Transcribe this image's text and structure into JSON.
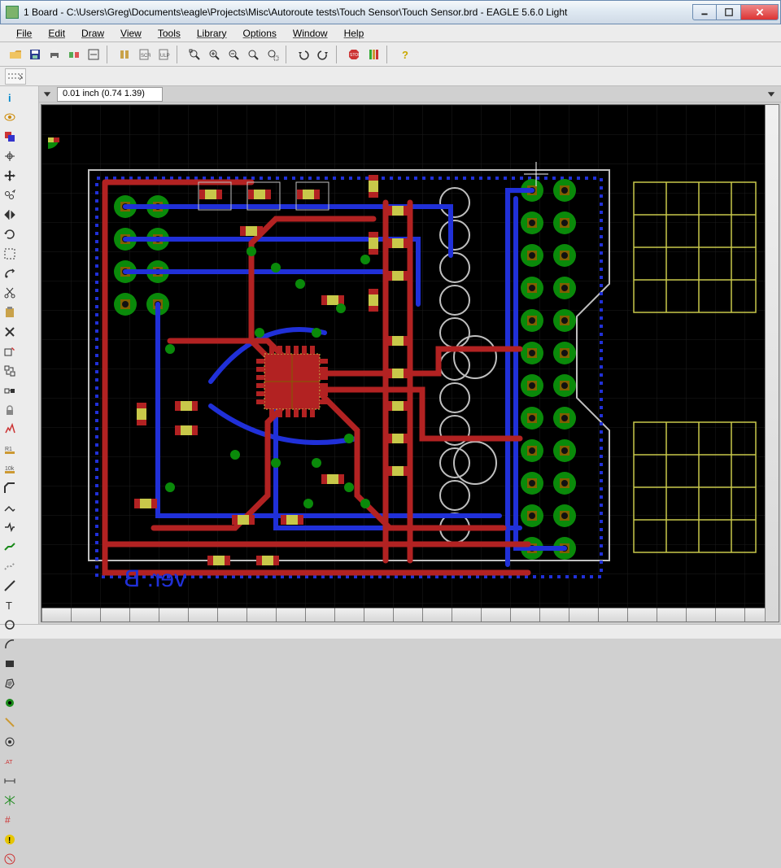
{
  "window": {
    "title": "1 Board - C:\\Users\\Greg\\Documents\\eagle\\Projects\\Misc\\Autoroute tests\\Touch Sensor\\Touch Sensor.brd - EAGLE 5.6.0 Light"
  },
  "menu": {
    "items": [
      "File",
      "Edit",
      "Draw",
      "View",
      "Tools",
      "Library",
      "Options",
      "Window",
      "Help"
    ]
  },
  "toolbar_top": {
    "open": "open",
    "save": "save",
    "print": "print",
    "cam": "cam",
    "board": "board",
    "lib": "lib",
    "script": "script",
    "ulp": "ulp",
    "zoomfit": "zoomfit",
    "zoomin": "zoomin",
    "zoomout": "zoomout",
    "redraw": "redraw",
    "zoomsel": "zoomsel",
    "undo": "undo",
    "redo": "redo",
    "stop": "stop",
    "go": "go",
    "help": "?"
  },
  "coord": {
    "value": "0.01 inch (0.74 1.39)"
  },
  "toolbox": {
    "items": [
      "info",
      "show",
      "layer",
      "move",
      "copy",
      "mirror",
      "rotate",
      "group",
      "change",
      "cut",
      "paste",
      "delete",
      "add",
      "pinswap",
      "replace",
      "lock",
      "name",
      "value",
      "smash",
      "miter",
      "split",
      "route",
      "ripup",
      "wire",
      "text",
      "circle",
      "arc",
      "rect",
      "poly",
      "via",
      "signal",
      "hole",
      "ratsnest",
      "auto",
      "drc",
      "errors",
      "mark"
    ]
  },
  "pcb": {
    "silk_text": "ver. B",
    "colors": {
      "top": "#b22222",
      "bottom": "#2030d8",
      "pad": "#0a8a0a",
      "via": "#0a8a0a",
      "silk": "#c8c84a",
      "outline": "#bfbfbf",
      "mask": "#806000",
      "hole": "#1a1a1a"
    }
  }
}
